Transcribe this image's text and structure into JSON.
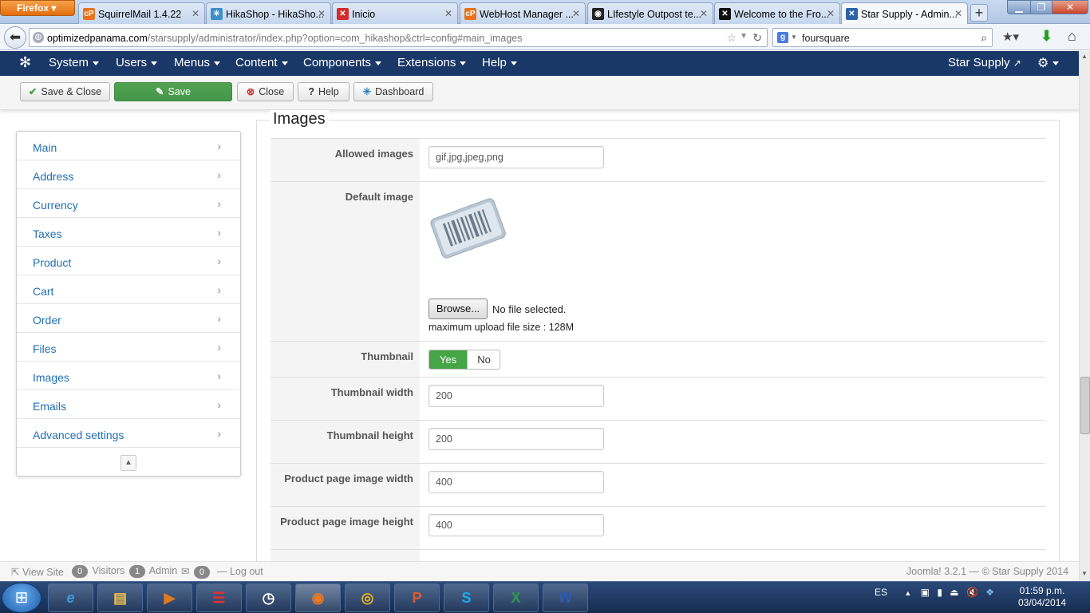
{
  "browser": {
    "menu_label": "Firefox",
    "tabs": [
      {
        "label": "SquirrelMail 1.4.22",
        "icon": "cpanel-icon",
        "color": "#e8731a",
        "glyph": "cP"
      },
      {
        "label": "HikaShop - HikaSho...",
        "icon": "hikashop-icon",
        "color": "#3a8fc7",
        "glyph": "✳"
      },
      {
        "label": "Inicio",
        "icon": "joomla-icon",
        "color": "#d22b2b",
        "glyph": "✕"
      },
      {
        "label": "WebHost Manager ...",
        "icon": "cpanel-icon",
        "color": "#e8731a",
        "glyph": "cP"
      },
      {
        "label": "LIfestyle Outpost te...",
        "icon": "site-icon",
        "color": "#222222",
        "glyph": "◉"
      },
      {
        "label": "Welcome to the Fro...",
        "icon": "joomla-icon",
        "color": "#111111",
        "glyph": "✕"
      },
      {
        "label": "Star Supply - Admin...",
        "icon": "joomla-icon",
        "color": "#2a62a8",
        "glyph": "✕"
      }
    ],
    "new_tab_label": "+",
    "url_host": "optimizedpanama.com",
    "url_path": "/starsupply/administrator/index.php?option=com_hikashop&ctrl=config#main_images",
    "search_value": "foursquare"
  },
  "joomla_nav": {
    "items": [
      "System",
      "Users",
      "Menus",
      "Content",
      "Components",
      "Extensions",
      "Help"
    ],
    "site_name": "Star Supply"
  },
  "toolbar": {
    "save_close": "Save & Close",
    "save": "Save",
    "close": "Close",
    "help": "Help",
    "dashboard": "Dashboard"
  },
  "sidebar": {
    "items": [
      "Main",
      "Address",
      "Currency",
      "Taxes",
      "Product",
      "Cart",
      "Order",
      "Files",
      "Images",
      "Emails",
      "Advanced settings"
    ]
  },
  "images_section": {
    "legend": "Images",
    "allowed_images_label": "Allowed images",
    "allowed_images_value": "gif,jpg,jpeg,png",
    "default_image_label": "Default image",
    "browse_label": "Browse...",
    "no_file_text": "No file selected.",
    "max_upload_text": "maximum upload file size : 128M",
    "thumbnail_label": "Thumbnail",
    "thumbnail_yes": "Yes",
    "thumbnail_no": "No",
    "thumbnail_width_label": "Thumbnail width",
    "thumbnail_width_value": "200",
    "thumbnail_height_label": "Thumbnail height",
    "thumbnail_height_value": "200",
    "product_width_label": "Product page image width",
    "product_width_value": "400",
    "product_height_label": "Product page image height",
    "product_height_value": "400"
  },
  "status": {
    "view_site": "View Site",
    "visitors_count": "0",
    "visitors_label": "Visitors",
    "admin_count": "1",
    "admin_label": "Admin",
    "messages_count": "0",
    "logout": "Log out",
    "version": "Joomla! 3.2.1 — © Star Supply 2014"
  },
  "taskbar": {
    "language": "ES",
    "time": "01:59 p.m.",
    "date": "03/04/2014"
  }
}
